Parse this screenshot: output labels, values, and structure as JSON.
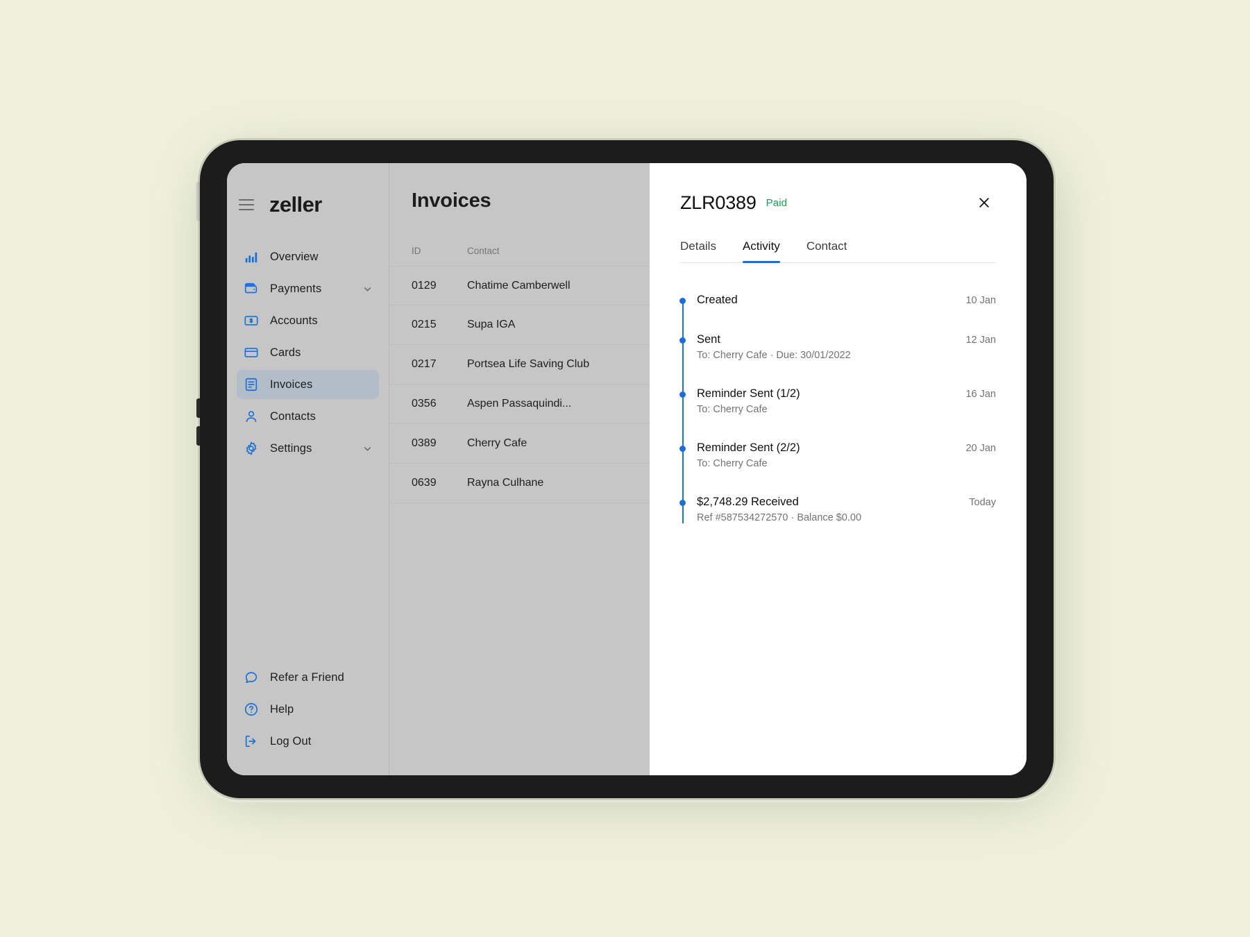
{
  "sidebar": {
    "brand": "zeller",
    "menu_icon": "hamburger-icon",
    "items": [
      {
        "label": "Overview",
        "icon": "bar-chart-icon",
        "active": false,
        "chevron": false
      },
      {
        "label": "Payments",
        "icon": "wallet-icon",
        "active": false,
        "chevron": true
      },
      {
        "label": "Accounts",
        "icon": "money-note-icon",
        "active": false,
        "chevron": false
      },
      {
        "label": "Cards",
        "icon": "credit-card-icon",
        "active": false,
        "chevron": false
      },
      {
        "label": "Invoices",
        "icon": "invoice-document-icon",
        "active": true,
        "chevron": false
      },
      {
        "label": "Contacts",
        "icon": "person-icon",
        "active": false,
        "chevron": false
      },
      {
        "label": "Settings",
        "icon": "gear-icon",
        "active": false,
        "chevron": true
      }
    ],
    "bottom_items": [
      {
        "label": "Refer a Friend",
        "icon": "chat-bubble-icon"
      },
      {
        "label": "Help",
        "icon": "question-circle-icon"
      },
      {
        "label": "Log Out",
        "icon": "logout-arrow-icon"
      }
    ]
  },
  "list": {
    "title": "Invoices",
    "columns": {
      "id": "ID",
      "contact": "Contact"
    },
    "rows": [
      {
        "id": "0129",
        "contact": "Chatime Camberwell"
      },
      {
        "id": "0215",
        "contact": "Supa IGA"
      },
      {
        "id": "0217",
        "contact": "Portsea Life Saving Club"
      },
      {
        "id": "0356",
        "contact": "Aspen Passaquindi..."
      },
      {
        "id": "0389",
        "contact": "Cherry Cafe"
      },
      {
        "id": "0639",
        "contact": "Rayna Culhane"
      }
    ]
  },
  "detail": {
    "invoice_number": "ZLR0389",
    "status": "Paid",
    "status_color": "#12a150",
    "close_icon": "close-icon",
    "tabs": [
      {
        "label": "Details",
        "active": false
      },
      {
        "label": "Activity",
        "active": true
      },
      {
        "label": "Contact",
        "active": false
      }
    ],
    "accent_color": "#1a6fd4",
    "activity": [
      {
        "title": "Created",
        "date": "10 Jan",
        "sub": ""
      },
      {
        "title": "Sent",
        "date": "12 Jan",
        "sub": "To: Cherry Cafe · Due: 30/01/2022"
      },
      {
        "title": "Reminder Sent (1/2)",
        "date": "16 Jan",
        "sub": "To: Cherry Cafe"
      },
      {
        "title": "Reminder Sent (2/2)",
        "date": "20 Jan",
        "sub": "To: Cherry Cafe"
      },
      {
        "title": "$2,748.29 Received",
        "date": "Today",
        "sub": "Ref #587534272570 · Balance $0.00"
      }
    ]
  }
}
